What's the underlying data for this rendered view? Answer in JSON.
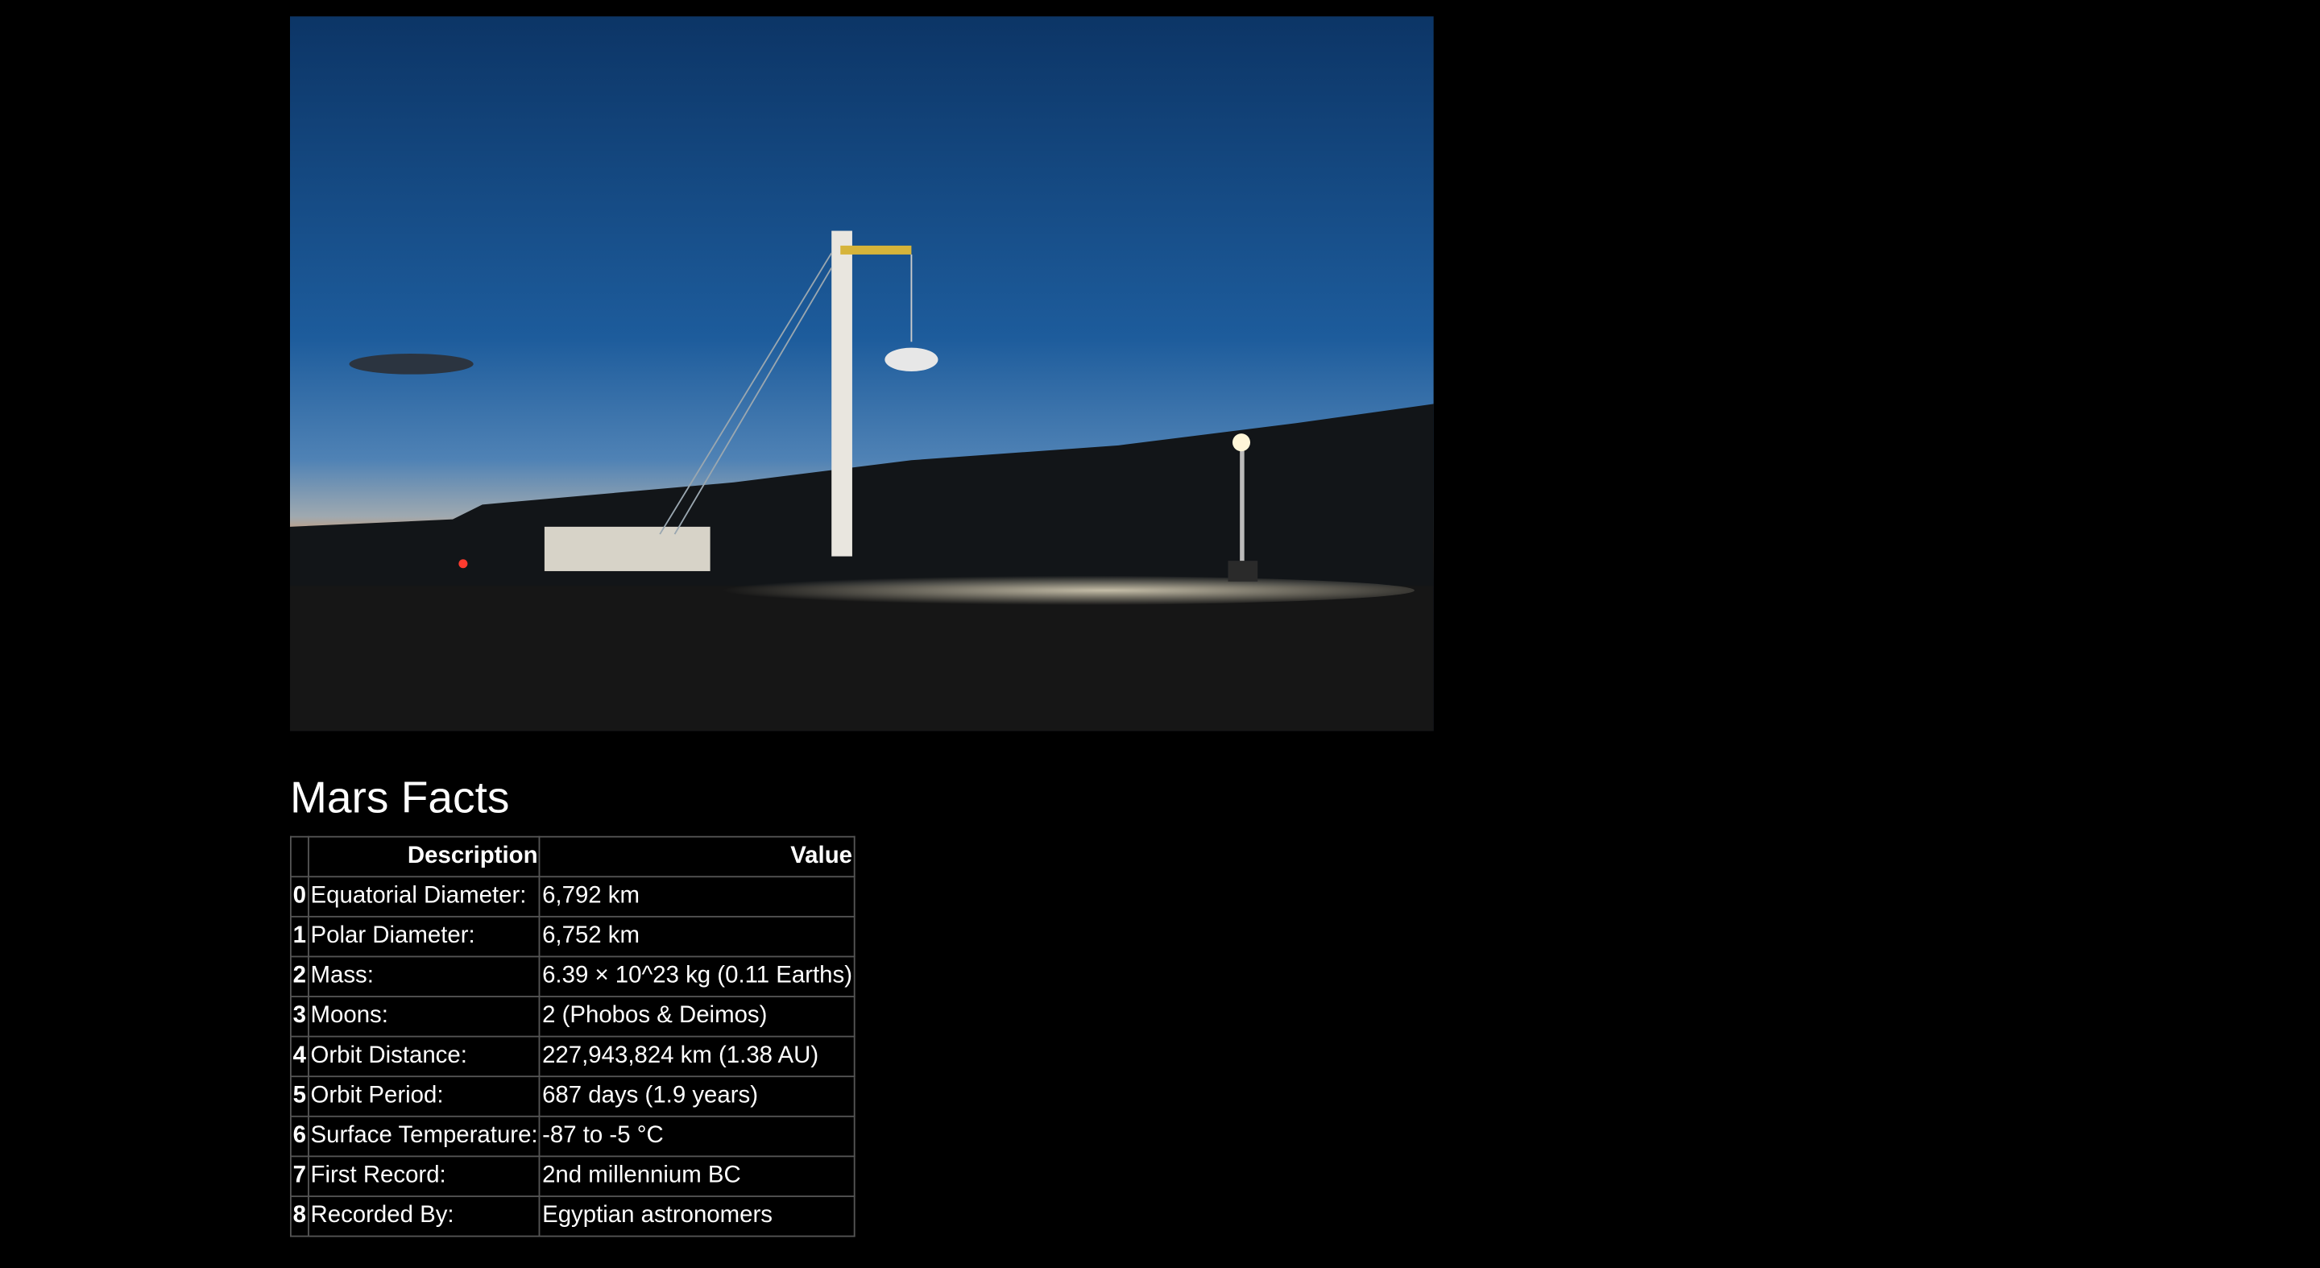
{
  "hero": {
    "image_icon": "launch-tower-at-dusk-photo",
    "colors": {
      "sky_top": "#0d3b6e",
      "sky_mid": "#1f5f9e",
      "horizon": "#e08a4a",
      "ground": "#141414"
    }
  },
  "facts": {
    "title": "Mars Facts",
    "columns": {
      "index": "",
      "description": "Description",
      "value": "Value"
    },
    "rows": [
      {
        "idx": "0",
        "description": "Equatorial Diameter:",
        "value": "6,792 km"
      },
      {
        "idx": "1",
        "description": "Polar Diameter:",
        "value": "6,752 km"
      },
      {
        "idx": "2",
        "description": "Mass:",
        "value": "6.39 × 10^23 kg (0.11 Earths)"
      },
      {
        "idx": "3",
        "description": "Moons:",
        "value": "2 (Phobos & Deimos)"
      },
      {
        "idx": "4",
        "description": "Orbit Distance:",
        "value": "227,943,824 km (1.38 AU)"
      },
      {
        "idx": "5",
        "description": "Orbit Period:",
        "value": "687 days (1.9 years)"
      },
      {
        "idx": "6",
        "description": "Surface Temperature:",
        "value": "-87 to -5 °C"
      },
      {
        "idx": "7",
        "description": "First Record:",
        "value": "2nd millennium BC"
      },
      {
        "idx": "8",
        "description": "Recorded By:",
        "value": "Egyptian astronomers"
      }
    ]
  }
}
